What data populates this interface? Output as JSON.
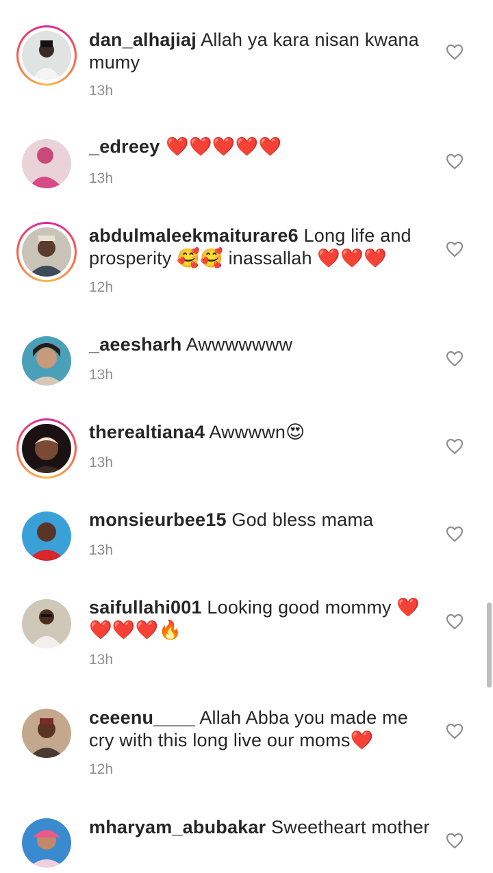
{
  "comments": [
    {
      "username": "dan_alhajiaj",
      "text": " Allah ya kara nisan kwana mumy",
      "time": "13h",
      "ring": true
    },
    {
      "username": "_edreey",
      "text": " ❤️❤️❤️❤️❤️",
      "time": "13h",
      "ring": false
    },
    {
      "username": "abdulmaleekmaiturare6",
      "text": " Long life and prosperity 🥰🥰 inassallah ❤️❤️❤️",
      "time": "12h",
      "ring": true
    },
    {
      "username": "_aeesharh",
      "text": " Awwwwwww",
      "time": "13h",
      "ring": false
    },
    {
      "username": "therealtiana4",
      "text": " Awwwwn😍",
      "time": "13h",
      "ring": true
    },
    {
      "username": "monsieurbee15",
      "text": " God bless mama",
      "time": "13h",
      "ring": false
    },
    {
      "username": "saifullahi001",
      "text": " Looking good mommy ❤️❤️❤️❤️🔥",
      "time": "13h",
      "ring": false
    },
    {
      "username": "ceeenu____",
      "text": " Allah Abba you made me cry with this long live our moms❤️",
      "time": "12h",
      "ring": false
    },
    {
      "username": "mharyam_abubakar",
      "text": " Sweetheart mother",
      "time": "",
      "ring": false
    }
  ],
  "icons": {
    "like": "heart-outline-icon"
  },
  "colors": {
    "username": "#262626",
    "timestamp": "#8e8e8e",
    "story_ring": "#d6249f"
  }
}
